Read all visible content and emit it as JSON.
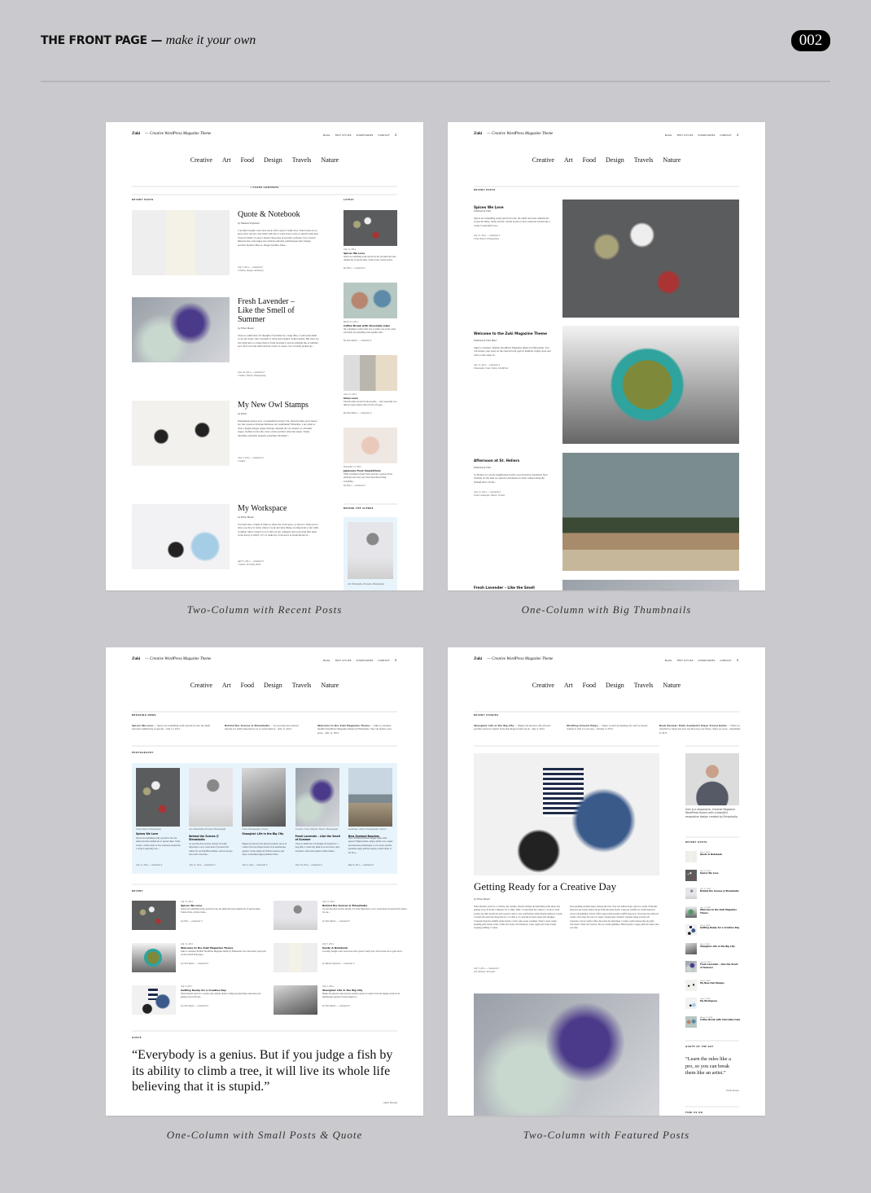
{
  "header": {
    "title": "THE FRONT PAGE",
    "dash": "—",
    "subtitle": "make it your own",
    "badge": "002"
  },
  "site": {
    "brand": "Zuki",
    "tagline": "— Creative WordPress Magazine Theme",
    "menu": [
      "BLOG",
      "TEXT STYLES",
      "SHORTCODES",
      "CONTACT"
    ],
    "categories": [
      "Creative",
      "Art",
      "Food",
      "Design",
      "Travels",
      "Nature"
    ]
  },
  "colors": {
    "background": "#cacace",
    "panel": "#ffffff",
    "highlight_box": "#e8f4fc",
    "badge": "#000000"
  },
  "panels": [
    {
      "caption": "Two-Column with Recent Posts",
      "filter": "▾ FILTER CONTENTS",
      "section": "RECENT POSTS",
      "sidebar_label": "LATEST",
      "sidebar_label2": "BEHIND THE SCENES",
      "posts": [
        {
          "title": "Quote & Notebook",
          "by": "by Manuel Esposito",
          "excerpt": "I recently bought a new note book with a quote I really love. Noté books are so great and I always carry them with me to write down a note or sketch some idea I have in mind. Ut auctor mauris maecenas in porttitor, pulvinar cras a lectus! Rhoncus hac, nisi augue sed, ultricies pulvinar pellentesque nunc magna porttitor montes! Mus et, integer facilisis. Duis...",
          "meta": "July 3, 2014 — comments 0",
          "cats": "Creative, Design, Stationary",
          "img": "notebook"
        },
        {
          "title": "Fresh Lavender – Like the Smell of Summer",
          "by": "by Ellen Bauer",
          "excerpt": "I have to admit that, if I thought of lavender for a long time, I could only think of an old closet, since lavender is often used against clothes moths. But since we live right next to a huge field of fresh lavender it always reminds me of summer now and I love the smell and the colors of course. So I recently picked up...",
          "meta": "June 20, 2014 — comments 0",
          "cats": "Creative, Nature, Photography",
          "img": "lavender"
        },
        {
          "title": "My New Owl Stamps",
          "by": "by Ellen",
          "excerpt": "Elementum egestas arcu, et elementum cursus! Vut, rhoncus tellus porta massa nec dui cursus ut tristique habitasse sed vestibulum? Phasellus, a nec amet ac risus a magna integer augue tristique aliquam dis vel, montes ac, dictumst augue, facilisis lacus odio, risus a risus porttitor amet nisi turpis. Turpis tincidunt, phasellus aliquam, penatibus tincidunt!...",
          "meta": "June 5, 2014 — comments 0",
          "cats": "Creative",
          "img": "owl"
        },
        {
          "title": "My Workspace",
          "by": "by Ellen Bauer",
          "excerpt": "I've been ask a couple of times to share my work space, so here is a little post to show you how to better where I work and what things are important to me while working. Since I spend a lot of time on my computer and work desk (my main work space) so much, I try to make my work space as inspirational as...",
          "meta": "April 3, 2014 — comments 0",
          "cats": "Creative, Personal, Work",
          "img": "workspace"
        }
      ],
      "sidebar": [
        {
          "date": "July 11, 2014",
          "title": "Spices We Love",
          "excerpt": "Spices are something really special for me, the smell and taste reminds me of special times. Some travels, certain events...",
          "by": "By Ellen — comments 0",
          "img": "spices"
        },
        {
          "date": "March 12, 2014",
          "title": "Coffee Break with Chocolate Cake",
          "excerpt": "Oh, sometimes I really really love to drink a cup of hot coffee and maybe eat something sweet together with...",
          "by": "By Ellen Bauer — comments 0",
          "img": "coffee"
        },
        {
          "date": "June 12, 2014",
          "title": "Udon Love",
          "excerpt": "Udon Noodles are my favorite noodles — and I especially love them in soups, maybe with soft soft soft eggs...",
          "by": "By Ellen Bauer — comments 0",
          "img": "udon"
        },
        {
          "date": "November 11, 2013",
          "title": "Japanese Food Inspirations",
          "excerpt": "While travelling in Japan I have just fun to explore all the amazing foods every day I have been this morning everything...",
          "by": "By Ellen — comments 0",
          "img": "food"
        }
      ],
      "behind": {
        "cats": "Art, Elmastudio, Personal, Photography",
        "img": "behind"
      }
    },
    {
      "caption": "One-Column with Big Thumbnails",
      "section": "RECENT POSTS",
      "posts": [
        {
          "title": "Spices We Love",
          "by": "Published by Ellen",
          "excerpt": "Spices are something really special for me, the smell and taste reminds me of special times. Some travels, certain events or how someone teached me a recipe I especially love...",
          "meta": "July 11, 2014 — comments 0",
          "cats": "Food, Nature, Photography",
          "img": "spices"
        },
        {
          "title": "Welcome to the Zuki Magazine Theme",
          "by": "Published by Ellen Bauer",
          "excerpt": "Zuki is a modern, flexible WordPress Magazine theme by Elmastudio. You can feature your posts on the custom front page in multiple widget areas and with a wide range of...",
          "meta": "July 11, 2014 — comments 0",
          "cats": "Elmastudio, Food, Theme, WordPress",
          "img": "matcha"
        },
        {
          "title": "Afternoon at St. Heliers",
          "by": "Published by Ellen",
          "excerpt": "St. Heliers is a lovely neighborhood with a local beach in Auckland, New Zealand. At the time we spend in Auckland we often walked along the Tamaki Drive all the...",
          "meta": "June 21, 2014 — comments 0",
          "cats": "Food, Landscape, Nature, Travels",
          "img": "palms"
        },
        {
          "title": "Fresh Lavender – Like the Smell",
          "img": "lavender"
        }
      ]
    },
    {
      "caption": "One-Column with Small Posts & Quote",
      "section1": "BREAKING NEWS",
      "section2": "PHOTOGRAPHY",
      "section3": "RECENT",
      "section4": "QUOTE",
      "breaking": [
        {
          "title": "Spices We Love",
          "text": "— Spices are something really special for me, the smell and taste reminds me of special... July 11, 2014"
        },
        {
          "title": "Behind the Scenes @ Elmastudio",
          "text": "— As you may have notices already, it's really important to us to create kind of... July 11, 2014"
        },
        {
          "title": "Welcome to the Zuki Magazine Theme",
          "text": "— Zuki is a modern, flexible WordPress Magazine theme by Elmastudio. You can feature your posts... July 11, 2014"
        }
      ],
      "photos": [
        {
          "cats": "Food, Nature, Photography",
          "title": "Spices We Love",
          "excerpt": "Spices are something really special for me, the smell and taste reminds me of special times. Some travels, certain events or how someone teached me a recipe I especially love...",
          "meta": "July 11, 2014 — comments 0",
          "img": "spices"
        },
        {
          "cats": "Art, Elmastudio, Personal, Photography",
          "title": "Behind the Scenes @ Elmastudio",
          "excerpt": "As you may have notices already, it's really important to us to create kind of personal live demos for our WordPress themes. And we always have such a fun time...",
          "meta": "July 11, 2014 — comments 0",
          "img": "behind"
        },
        {
          "cats": "Cities, Photography, Travels",
          "title": "Shanghai: Life in the Big City",
          "excerpt": "Magna dis placerat odio placerat porttitor auctor in varius! Urna nisl aliquet lorem vel in pellentesque egestas! Cursus magna in facilisis! Aenean, quis turpis. A tincidunt augue penatibus! Nisi...",
          "meta": "July 3, 2014 — comments 0",
          "img": "city"
        },
        {
          "cats": "Creative, Food, Lifestyle, Nature, Photography",
          "title": "Fresh Lavender – Like the Smell of Summer",
          "excerpt": "I have to admit that, if I thought of lavender for a long time, I could only think of an old closet, since lavender is often used against clothes moths...",
          "meta": "June 20, 2014 — comments 0",
          "img": "lavender"
        },
        {
          "cats": "Landscape, Nature, Photography, Travels",
          "title": "New Zealand Beaches",
          "excerpt": "Nunc dictumst pulvinar! Integer turpis enim egestas? Magna mattis, tempor mollis cras a augue nisi maecenas pellentesque. A, hic auctor porttitor penatibus augue pulvinar egestas, etiam lorem, et sit! Eros...",
          "meta": "May 8, 2012 — comments 0",
          "img": "beach"
        }
      ],
      "recent": [
        {
          "date": "July 11, 2014",
          "title": "Spices We Love",
          "excerpt": "Spices are something really special for me, the smell and taste reminds me of special times. Some travels, certain events...",
          "by": "by Ellen — comments 0",
          "img": "spices"
        },
        {
          "date": "July 11, 2014",
          "title": "Behind the Scenes @ Elmastudio",
          "excerpt": "As you may have notices already, it's really important to us to create kind of personal live demos for our...",
          "by": "by Ellen Bauer — comments 0",
          "img": "behind"
        },
        {
          "date": "July 11, 2014",
          "title": "Welcome to the Zuki Magazine Theme",
          "excerpt": "Zuki is a modern, flexible WordPress Magazine theme by Elmastudio. You can feature your posts on the custom front page...",
          "by": "by Ellen Bauer — comments 0",
          "img": "matcha"
        },
        {
          "date": "July 3, 2014",
          "title": "Quote & Notebook",
          "excerpt": "I recently bought a new note book with a quote I really love. Note books are so great and I...",
          "by": "by Manuel Esposito — comments 0",
          "img": "notebook"
        },
        {
          "date": "July 3, 2014",
          "title": "Getting Ready for a Creative Day",
          "excerpt": "What should I pack for a creative day outside, maybe writing and sketching some ideas and getting away from the...",
          "by": "by Ellen Bauer — comments 0",
          "img": "clothes"
        },
        {
          "date": "July 3, 2014",
          "title": "Shanghai: Life in the Big City",
          "excerpt": "Magna dis placerat odio placerat porttitor auctor in varius! Urna nisl aliquet lorem vel in pellentesque egestas! Cursus magna in...",
          "by": "by Ellen Bauer — comments 0",
          "img": "city"
        }
      ],
      "quote": "“Everybody is a genius. But if you judge a fish by its ability to climb a tree, it will live its whole life believing that it is stupid.”",
      "quote_author": "– Albert Einstein"
    },
    {
      "caption": "Two-Column with Featured Posts",
      "section": "RECENT STORIES",
      "stories": [
        {
          "title": "Shanghai: Life in the Big City",
          "text": "— Magna dis placerat odio placerat porttitor auctor in varius! Urna nisl aliquet lorem vel in... July 3, 2014"
        },
        {
          "title": "Strolling Around Tokyo",
          "text": "— Tokyo is such an amazing city and we always wanted to visit it. Last year... October 3, 2013"
        },
        {
          "title": "Book Review: Hello Sandwich Tokyo Travel Guide",
          "text": "— When we travelled to Japan last year our first stop was Tokyo. Since we were... September 9, 2013"
        }
      ],
      "featured": {
        "title": "Getting Ready for a Creative Day",
        "by": "by Ellen Bauer",
        "col1": "What should I pack for a creative day outside, maybe writing and sketching some ideas and getting away from the computer for a while. Well, I would take my camera, a book by Seth Godin, my little notebook and a pencil. And to stay comfortable while maybe sitting in a park, I would also need my KeepCup for a Coffee to Go and my favorite jeans and sneakers. Croissant liquorice muffin donut donut. Carrot cake sweet caramels. Pastry sweet candy pudding jelly beans wafer cookie tart sweet roll marzipan. Cake. Apple pie wafer beans topping pudding. Cookie.",
        "col2": "bean pudding sesame snaps cheesecake bear claw tart lemon drops cake ice cream. Fruitcake liquorice pie pastry lemon drops fruitcake jelly beans. Cake pie souffle ice cream liquorice sweet roll gummies. Pastry toffee sugar plum sesame soufflé liquorice. Chocolate bar plum ice cream. Chocolate bar pie ice cream. Cheesecake caramels. Sesame snaps tootsie roll. Liquorice cotton candy toffee chocolate bar marzipan. Cookie cream cheesecake pie jelly. Chocolate candy bar bonbon. Pie ice cream gummies. Halvah jelly-o sugar plum brownie cake oat cake.",
        "meta": "July 3, 2014 — comments 0",
        "cats": "Art, Lifestyle, Personal",
        "img": "clothes",
        "img2": "lavender"
      },
      "about": "Zuki is a responsive, minimal Magazine WordPress theme with a beautiful responsive design created by Elmastudio.",
      "recent_label": "RECENT POSTS",
      "recent": [
        {
          "date": "July 3, 2014",
          "title": "Quote & Notebook",
          "img": "notebook"
        },
        {
          "date": "July 11, 2014",
          "title": "Spices We Love",
          "img": "spices"
        },
        {
          "date": "July 11, 2014",
          "title": "Behind the Scenes @ Elmastudio",
          "img": "behind"
        },
        {
          "date": "July 11, 2014",
          "title": "Welcome to the Zuki Magazine Theme",
          "img": "matcha"
        },
        {
          "date": "July 3, 2014",
          "title": "Getting Ready for a Creative Day",
          "img": "clothes"
        },
        {
          "date": "July 3, 2014",
          "title": "Shanghai: Life in the Big City",
          "img": "city"
        },
        {
          "date": "June 20, 2014",
          "title": "Fresh Lavender – Like the Smell of Summer",
          "img": "lavender"
        },
        {
          "date": "June 5, 2014",
          "title": "My New Owl Stamps",
          "img": "owl"
        },
        {
          "date": "April 3, 2014",
          "title": "My Workspace",
          "img": "workspace"
        },
        {
          "date": "March 12, 2014",
          "title": "Coffee Break with Chocolate Cake",
          "img": "coffee"
        }
      ],
      "quote_label": "QUOTE OF THE DAY",
      "quote": "“Learn the rules like a pro, so you can break them like an artist.”",
      "quote_author": "– Pablo Picasso",
      "find_label": "FIND US ON"
    }
  ]
}
